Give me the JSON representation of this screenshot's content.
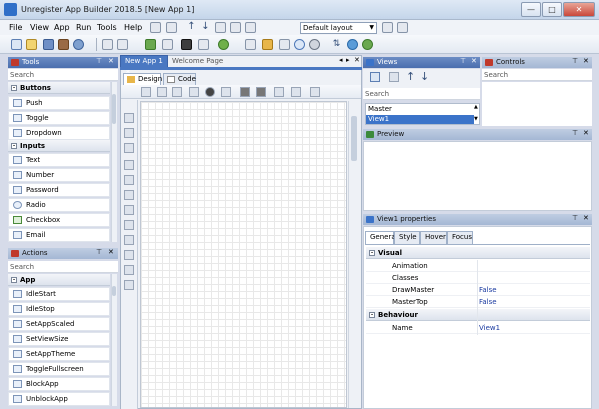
{
  "window": {
    "title": "Unregister App Builder 2018.5 [New App 1]",
    "minimize": "—",
    "maximize": "□",
    "close": "✕"
  },
  "menu": [
    "File",
    "View",
    "App",
    "Run",
    "Tools",
    "Help"
  ],
  "toolbar": {
    "layout_select": "Default layout"
  },
  "tools_panel": {
    "title": "Tools",
    "search_placeholder": "Search",
    "groups": [
      {
        "name": "Buttons",
        "items": [
          "Push",
          "Toggle",
          "Dropdown"
        ]
      },
      {
        "name": "Inputs",
        "items": [
          "Text",
          "Number",
          "Password",
          "Radio",
          "Checkbox",
          "Email"
        ]
      }
    ]
  },
  "actions_panel": {
    "title": "Actions",
    "search_placeholder": "Search",
    "groups": [
      {
        "name": "App",
        "items": [
          "IdleStart",
          "IdleStop",
          "SetAppScaled",
          "SetViewSize",
          "SetAppTheme",
          "ToggleFullscreen",
          "BlockApp",
          "UnblockApp"
        ]
      }
    ]
  },
  "doc_tabs": [
    {
      "label": "New App 1",
      "close": "✕"
    },
    {
      "label": "Welcome Page"
    }
  ],
  "doc_nav": {
    "left": "◂",
    "right": "▸",
    "close": "✕"
  },
  "editor_tabs": [
    "Design",
    "Code"
  ],
  "views_panel": {
    "title": "Views",
    "search_placeholder": "Search",
    "rows": [
      "Master",
      "View1"
    ]
  },
  "controls_panel": {
    "title": "Controls",
    "search_placeholder": "Search"
  },
  "preview_panel": {
    "title": "Preview"
  },
  "properties_panel": {
    "title": "View1 properties",
    "tabs": [
      "General",
      "Style",
      "Hover",
      "Focus"
    ],
    "sections": [
      {
        "name": "Visual",
        "rows": [
          [
            "Animation",
            ""
          ],
          [
            "Classes",
            ""
          ],
          [
            "DrawMaster",
            "False"
          ],
          [
            "MasterTop",
            "False"
          ]
        ]
      },
      {
        "name": "Behaviour",
        "rows": [
          [
            "Name",
            "View1"
          ]
        ]
      }
    ]
  },
  "panel_buttons": {
    "pin": "⊤",
    "close": "✕"
  },
  "colors": {
    "panel_header": "#4a6eae",
    "selection": "#3b73c9"
  }
}
